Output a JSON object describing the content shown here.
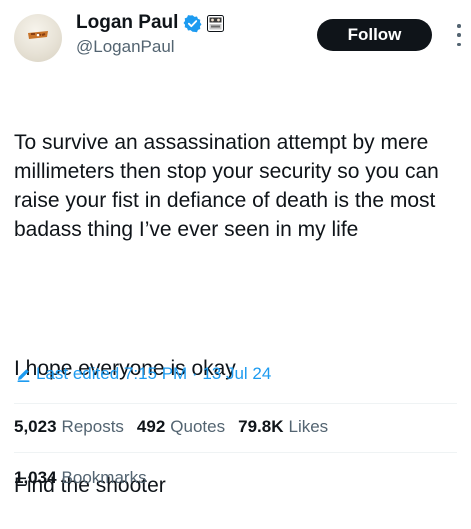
{
  "author": {
    "name": "Logan Paul",
    "handle": "@LoganPaul",
    "verified_color": "#1d9bf0"
  },
  "actions": {
    "follow_label": "Follow"
  },
  "icons": {
    "verified": "verified-badge-icon",
    "affiliate": "affiliate-badge-icon",
    "more": "more-options-icon",
    "edit": "pencil-icon"
  },
  "tweet": {
    "paragraphs": [
      "To survive an assassination attempt by mere millimeters then stop your security so you can raise your fist in defiance of death is the most badass thing I’ve ever seen in my life",
      "I hope everyone is okay",
      "Find the shooter"
    ],
    "edited_text": "Last edited 7:15 PM · 13 Jul 24"
  },
  "stats": {
    "reposts": {
      "count": "5,023",
      "label": "Reposts"
    },
    "quotes": {
      "count": "492",
      "label": "Quotes"
    },
    "likes": {
      "count": "79.8K",
      "label": "Likes"
    },
    "bookmarks": {
      "count": "1,034",
      "label": "Bookmarks"
    }
  },
  "colors": {
    "text": "#0f1419",
    "secondary": "#536471",
    "accent": "#1d9bf0",
    "follow_bg": "#0f1419"
  }
}
